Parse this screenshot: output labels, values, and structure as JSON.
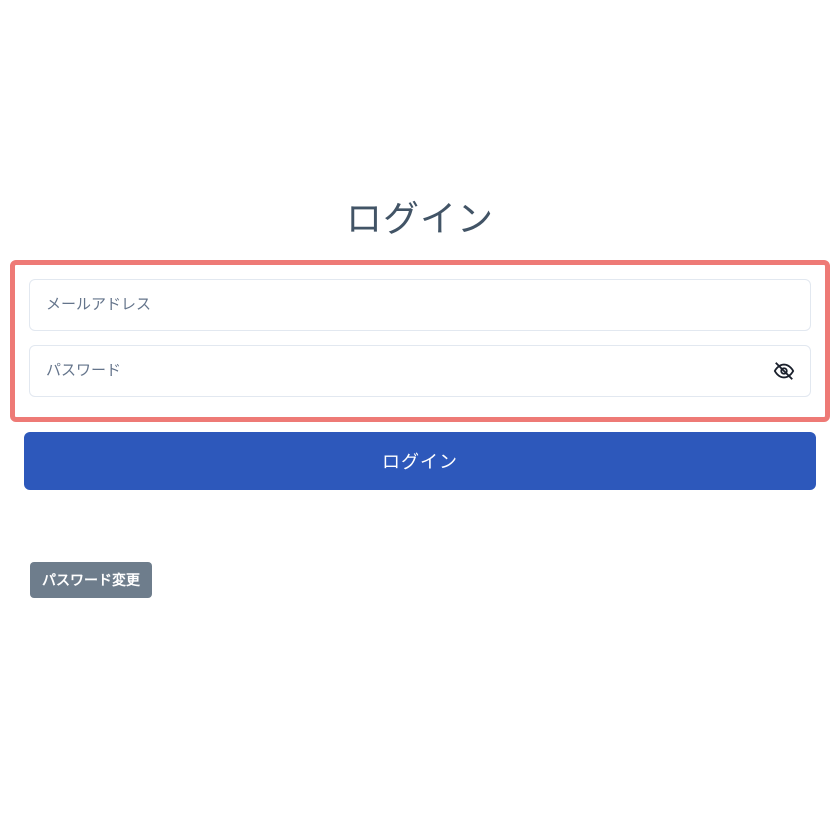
{
  "page": {
    "title": "ログイン"
  },
  "form": {
    "email_placeholder": "メールアドレス",
    "password_placeholder": "パスワード",
    "login_button_label": "ログイン",
    "password_change_label": "パスワード変更"
  }
}
